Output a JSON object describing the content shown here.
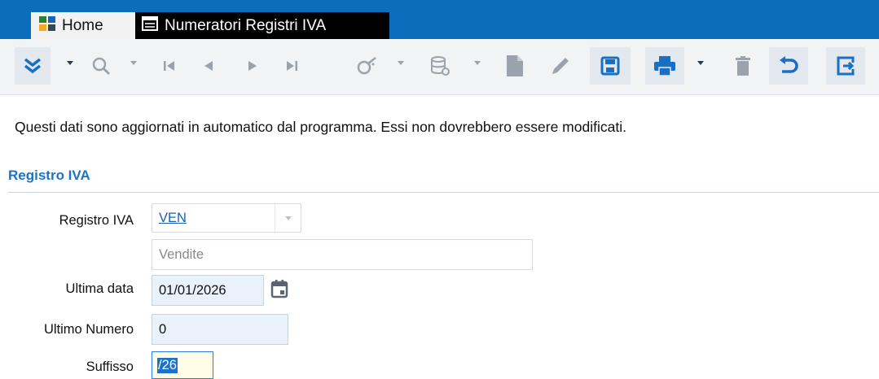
{
  "tabs": [
    {
      "label": "Home",
      "icon": "home-app-icon"
    },
    {
      "label": "Numeratori Registri IVA",
      "icon": "window-icon"
    }
  ],
  "toolbar": {
    "icons": [
      "expand-chevrons-icon",
      "search-icon",
      "first-record-icon",
      "previous-record-icon",
      "next-record-icon",
      "last-record-icon",
      "wizard-icon",
      "database-icon",
      "new-document-icon",
      "edit-pencil-icon",
      "save-icon",
      "print-icon",
      "delete-icon",
      "undo-icon",
      "exit-icon"
    ]
  },
  "notice": "Questi dati sono aggiornati in automatico dal programma. Essi non dovrebbero essere modificati.",
  "section": {
    "title": "Registro IVA"
  },
  "form": {
    "registro": {
      "label": "Registro IVA",
      "value": "VEN",
      "description": "Vendite"
    },
    "ultima_data": {
      "label": "Ultima data",
      "value": "01/01/2026"
    },
    "ultimo_numero": {
      "label": "Ultimo Numero",
      "value": "0"
    },
    "suffisso": {
      "label": "Suffisso",
      "value": "/26"
    }
  },
  "colors": {
    "accent": "#0a6ebd",
    "title": "#1a73c8",
    "toolbar_icon": "#1a6fc4"
  }
}
